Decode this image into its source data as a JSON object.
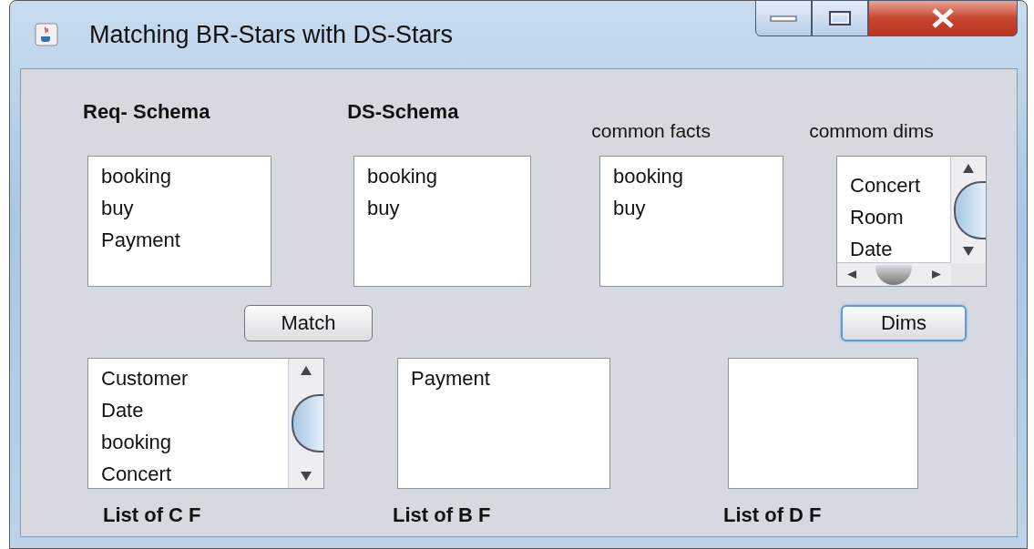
{
  "window": {
    "title": "Matching BR-Stars with DS-Stars"
  },
  "top_headings": [
    {
      "text": "Req- Schema",
      "bold": true
    },
    {
      "text": "DS-Schema",
      "bold": true
    },
    {
      "text": "common facts",
      "bold": false
    },
    {
      "text": "commom dims",
      "bold": false
    }
  ],
  "top_lists": [
    {
      "kind": "plain",
      "items": [
        "booking",
        "buy",
        "Payment"
      ]
    },
    {
      "kind": "plain",
      "items": [
        "booking",
        "buy"
      ]
    },
    {
      "kind": "plain",
      "items": [
        "booking",
        "buy"
      ]
    },
    {
      "kind": "both_scroll",
      "items": [
        "Concert",
        "Room",
        "Date"
      ]
    }
  ],
  "buttons": [
    {
      "label": "Match",
      "focused": false
    },
    {
      "label": "Dims",
      "focused": true
    }
  ],
  "bottom_lists": [
    {
      "kind": "vertical_scroll",
      "items": [
        "Customer",
        "Date",
        "booking",
        "Concert"
      ]
    },
    {
      "kind": "plain",
      "items": [
        "Payment"
      ]
    },
    {
      "kind": "plain"
    }
  ],
  "bottom_captions": [
    {
      "text": "List of C F"
    },
    {
      "text": "List of B F"
    },
    {
      "text": "List of D F"
    }
  ]
}
